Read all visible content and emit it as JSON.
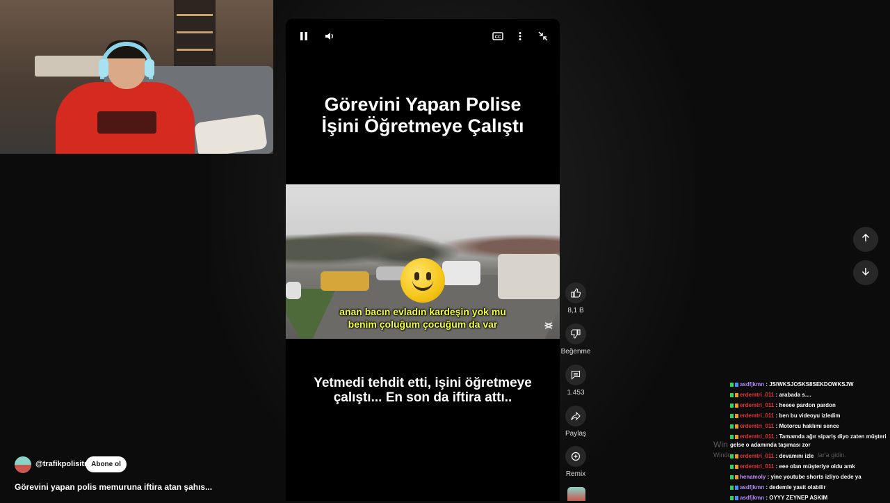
{
  "video": {
    "title": "Görevini Yapan Polise\nİşini Öğretmeye Çalıştı",
    "subtitle_line1": "anan bacın evladın kardeşin yok mu",
    "subtitle_line2": "benim çoluğum çocuğum da var",
    "bottom_caption": "Yetmedi tehdit etti, işini öğretmeye\nçalıştı... En son da iftira attı.."
  },
  "actions": {
    "likes": "8,1 B",
    "dislike": "Beğenme",
    "comments": "1.453",
    "share": "Paylaş",
    "remix": "Remix"
  },
  "channel": {
    "handle": "@trafikpolisitr",
    "subscribe": "Abone ol",
    "description": "Görevini yapan polis memuruna iftira atan şahıs..."
  },
  "chat": [
    {
      "user": "asdfjkmn",
      "color": "#b58cff",
      "msg": "JSIWKSJOSKS8SEKDOWKSJW"
    },
    {
      "user": "erdemtri_011",
      "color": "#e8343a",
      "msg": "arabada s...."
    },
    {
      "user": "erdemtri_011",
      "color": "#e8343a",
      "msg": "heeee pardon pardon"
    },
    {
      "user": "erdemtri_011",
      "color": "#e8343a",
      "msg": "ben bu videoyu izledim"
    },
    {
      "user": "erdemtri_011",
      "color": "#e8343a",
      "msg": "Motorcu haklımı sence"
    },
    {
      "user": "erdemtri_011",
      "color": "#e8343a",
      "msg": "Tamamda ağır sipariş diyo zaten müşteri gelse o adamında taşıması zor"
    },
    {
      "user": "erdemtri_011",
      "color": "#e8343a",
      "msg": "devamını izle"
    },
    {
      "user": "erdemtri_011",
      "color": "#e8343a",
      "msg": "eee olan müşteriye oldu amk"
    },
    {
      "user": "henamoly",
      "color": "#c98cff",
      "msg": "yine youtube shorts izliyo dede ya"
    },
    {
      "user": "asdfjkmn",
      "color": "#b58cff",
      "msg": "dedemle yasit olabilir"
    },
    {
      "user": "asdfjkmn",
      "color": "#b58cff",
      "msg": "OYYY ZEYNEP ASKIM"
    }
  ],
  "watermark": {
    "line1": "Win",
    "line2": "Windo",
    "line3": "lar'a gidin."
  },
  "icons": {
    "pause": "pause-icon",
    "volume": "volume-icon",
    "cc": "cc-icon",
    "more": "more-vert-icon",
    "exit_fullscreen": "exit-fullscreen-icon",
    "like": "thumb-up-icon",
    "dislike": "thumb-down-icon",
    "comment": "comment-icon",
    "share": "share-icon",
    "remix": "remix-icon",
    "up": "arrow-up-icon",
    "down": "arrow-down-icon"
  }
}
